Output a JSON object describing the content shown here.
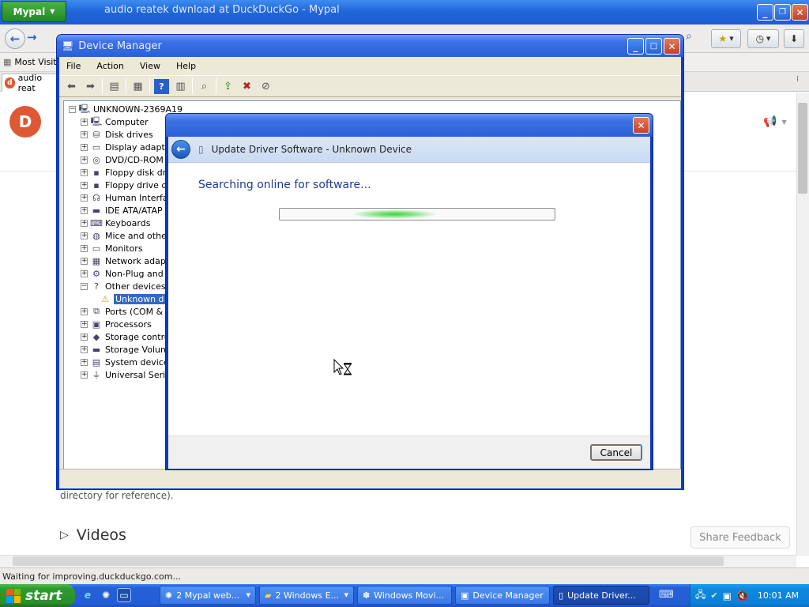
{
  "browser": {
    "app_button": "Mypal",
    "window_title": "audio reatek dwnload at DuckDuckGo - Mypal",
    "bookmarks": [
      "Most Visite"
    ],
    "tab_label": "audio reat",
    "status_text": "Waiting for improving.duckduckgo.com...",
    "page": {
      "snippet": "directory for reference).",
      "videos_heading": "Videos",
      "share_feedback": "Share Feedback"
    }
  },
  "device_manager": {
    "title": "Device Manager",
    "menu": [
      "File",
      "Action",
      "View",
      "Help"
    ],
    "root": "UNKNOWN-2369A19",
    "tree": [
      {
        "label": "Computer",
        "icon": "computer-icon",
        "expanded": false
      },
      {
        "label": "Disk drives",
        "icon": "disk-icon",
        "expanded": false
      },
      {
        "label": "Display adapte",
        "icon": "display-icon",
        "expanded": false
      },
      {
        "label": "DVD/CD-ROM d",
        "icon": "cdrom-icon",
        "expanded": false
      },
      {
        "label": "Floppy disk driv",
        "icon": "floppy-icon",
        "expanded": false
      },
      {
        "label": "Floppy drive co",
        "icon": "floppy-controller-icon",
        "expanded": false
      },
      {
        "label": "Human Interfa",
        "icon": "hid-icon",
        "expanded": false
      },
      {
        "label": "IDE ATA/ATAP",
        "icon": "ide-icon",
        "expanded": false
      },
      {
        "label": "Keyboards",
        "icon": "keyboard-icon",
        "expanded": false
      },
      {
        "label": "Mice and other",
        "icon": "mouse-icon",
        "expanded": false
      },
      {
        "label": "Monitors",
        "icon": "monitor-icon",
        "expanded": false
      },
      {
        "label": "Network adapt",
        "icon": "network-icon",
        "expanded": false
      },
      {
        "label": "Non-Plug and P",
        "icon": "nonpnp-icon",
        "expanded": false
      },
      {
        "label": "Other devices",
        "icon": "other-devices-icon",
        "expanded": true
      },
      {
        "label": "Unknown d",
        "icon": "warning-device-icon",
        "child": true,
        "selected": true
      },
      {
        "label": "Ports (COM & L",
        "icon": "port-icon",
        "expanded": false
      },
      {
        "label": "Processors",
        "icon": "processor-icon",
        "expanded": false
      },
      {
        "label": "Storage contro",
        "icon": "storage-controller-icon",
        "expanded": false
      },
      {
        "label": "Storage Volum",
        "icon": "storage-volume-icon",
        "expanded": false
      },
      {
        "label": "System devices",
        "icon": "system-icon",
        "expanded": false
      },
      {
        "label": "Universal Seria",
        "icon": "usb-icon",
        "expanded": false
      }
    ]
  },
  "dialog": {
    "header_title": "Update Driver Software - Unknown Device",
    "searching_text": "Searching online for software...",
    "cancel_label": "Cancel"
  },
  "taskbar": {
    "start_label": "start",
    "buttons": [
      {
        "label": "2 Mypal web...",
        "icon": "mypal-icon",
        "group": true,
        "active": false
      },
      {
        "label": "2 Windows E...",
        "icon": "folder-icon",
        "group": true,
        "active": false
      },
      {
        "label": "Windows Movi...",
        "icon": "movie-icon",
        "group": false,
        "active": false
      },
      {
        "label": "Device Manager",
        "icon": "device-manager-icon",
        "group": false,
        "active": false
      },
      {
        "label": "Update Driver...",
        "icon": "update-driver-icon",
        "group": false,
        "active": true
      }
    ],
    "clock": "10:01 AM"
  },
  "colors": {
    "xp_blue": "#245dd5",
    "start_green": "#2f9a2f",
    "selection": "#316ac5",
    "ddg_orange": "#de5833"
  }
}
